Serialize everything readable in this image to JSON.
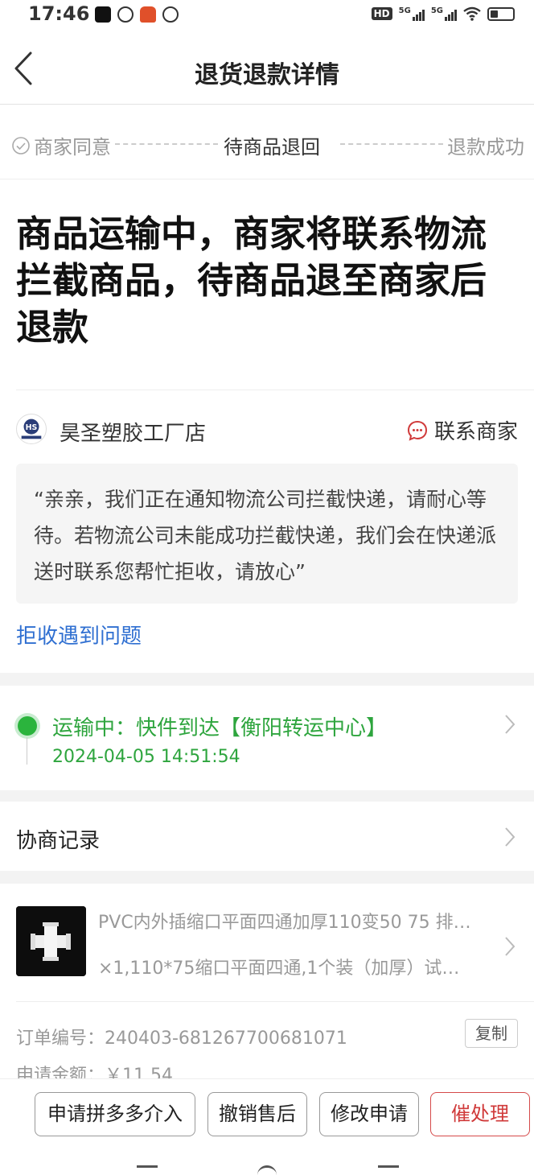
{
  "status_bar": {
    "time": "17:46",
    "hd": "HD",
    "network_1": "5G",
    "network_2": "5G"
  },
  "nav": {
    "title": "退货退款详情"
  },
  "progress": {
    "steps": [
      {
        "label": "商家同意",
        "state": "done"
      },
      {
        "label": "待商品退回",
        "state": "current"
      },
      {
        "label": "退款成功",
        "state": "pending"
      }
    ]
  },
  "headline": "商品运输中，商家将联系物流拦截商品，待商品退至商家后退款",
  "merchant": {
    "name": "昊圣塑胶工厂店",
    "contact_label": "联系商家",
    "message": "“亲亲，我们正在通知物流公司拦截快递，请耐心等待。若物流公司未能成功拦截快递，我们会在快递派送时联系您帮忙拒收，请放心”"
  },
  "reject_problem_link": "拒收遇到问题",
  "logistics": {
    "status": "运输中：快件到达【衡阳转运中心】",
    "time": "2024-04-05 14:51:54"
  },
  "negotiation": {
    "label": "协商记录"
  },
  "product": {
    "title": "PVC内外插缩口平面四通加厚110变50 75 排…",
    "spec": "×1,110*75缩口平面四通,1个装（加厚）试…"
  },
  "order": {
    "number_label": "订单编号：",
    "number": "240403-681267700681071",
    "copy_label": "复制",
    "amount_label": "申请金额：",
    "amount": "￥11.54"
  },
  "actions": {
    "platform_intervene": "申请拼多多介入",
    "cancel_aftersale": "撤销售后",
    "modify_request": "修改申请",
    "urge": "催处理"
  },
  "colors": {
    "green": "#2ea53e",
    "link_blue": "#2f6fd1",
    "urge_red": "#d03a3a"
  }
}
